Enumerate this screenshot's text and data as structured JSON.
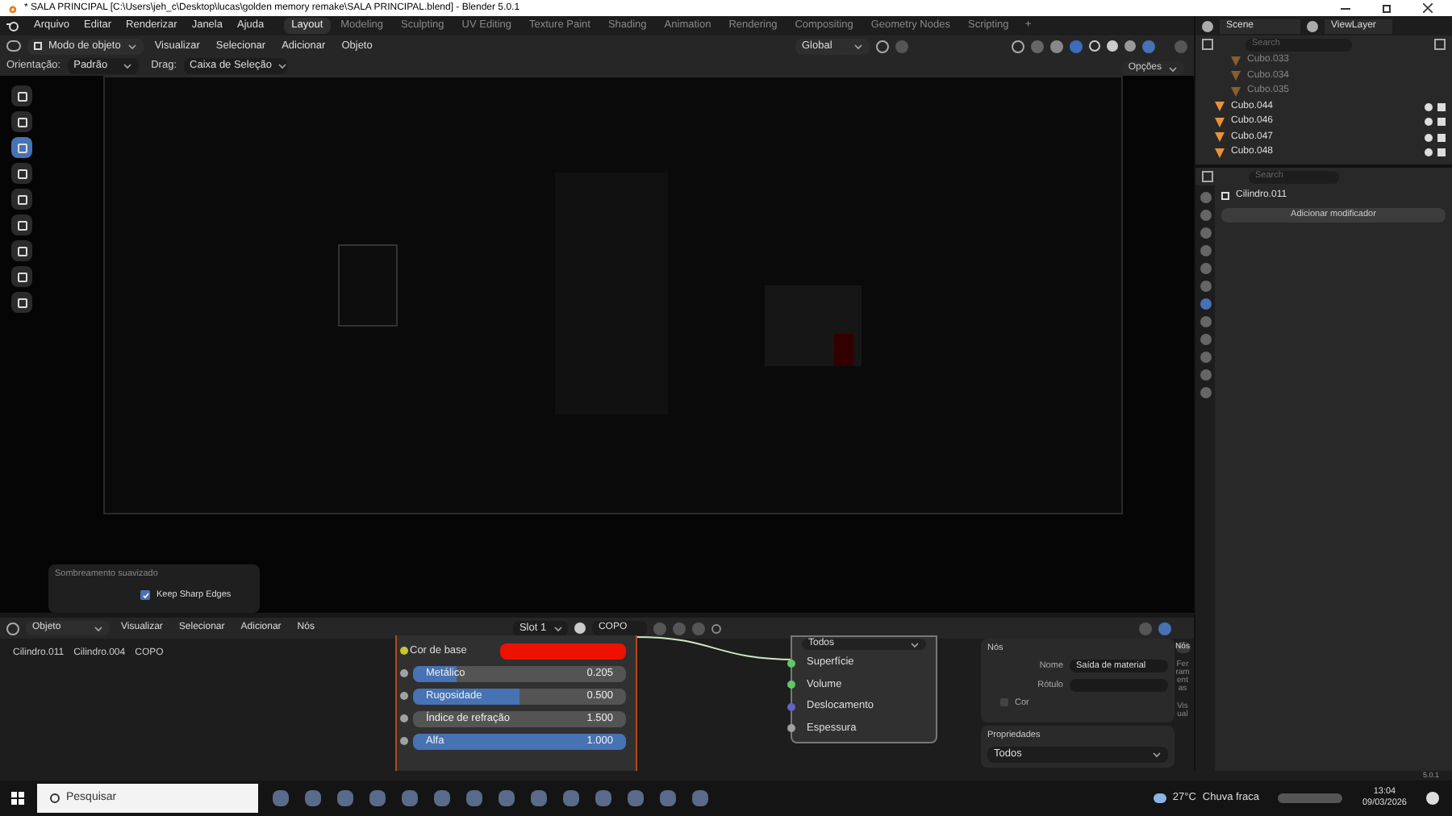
{
  "window": {
    "title": "* SALA PRINCIPAL [C:\\Users\\jeh_c\\Desktop\\lucas\\golden memory remake\\SALA PRINCIPAL.blend] - Blender 5.0.1"
  },
  "menu": [
    "Arquivo",
    "Editar",
    "Renderizar",
    "Janela",
    "Ajuda"
  ],
  "workspaces": [
    {
      "label": "Layout",
      "selected": true
    },
    {
      "label": "Modeling",
      "selected": false
    },
    {
      "label": "Sculpting",
      "selected": false
    },
    {
      "label": "UV Editing",
      "selected": false
    },
    {
      "label": "Texture Paint",
      "selected": false
    },
    {
      "label": "Shading",
      "selected": false
    },
    {
      "label": "Animation",
      "selected": false
    },
    {
      "label": "Rendering",
      "selected": false
    },
    {
      "label": "Compositing",
      "selected": false
    },
    {
      "label": "Geometry Nodes",
      "selected": false
    },
    {
      "label": "Scripting",
      "selected": false
    }
  ],
  "add_workspace": "+",
  "viewport_header": {
    "mode": "Modo de objeto",
    "menus": [
      "Visualizar",
      "Selecionar",
      "Adicionar",
      "Objeto"
    ],
    "orientation": "Global"
  },
  "tool_settings": {
    "orientation_label": "Orientação:",
    "orientation": "Padrão",
    "drag_label": "Drag:",
    "drag": "Caixa de Seleção",
    "options": "Opções"
  },
  "toolbar": [
    {
      "selected": false
    },
    {
      "selected": false
    },
    {
      "selected": true
    },
    {
      "selected": false
    },
    {
      "selected": false
    },
    {
      "selected": false
    },
    {
      "selected": false
    },
    {
      "selected": false
    },
    {
      "selected": false
    }
  ],
  "last_operator": {
    "title": "Sombreamento suavizado",
    "option": {
      "label": "Keep Sharp Edges",
      "checked": true
    }
  },
  "scene": {
    "name": "Scene",
    "view_layer": "ViewLayer"
  },
  "outliner": {
    "search_placeholder": "Search",
    "items": [
      {
        "name": "Cubo.033",
        "dimmed": true
      },
      {
        "name": "Cubo.034",
        "dimmed": true
      },
      {
        "name": "Cubo.035",
        "dimmed": true
      },
      {
        "name": "Cubo.044",
        "dimmed": false
      },
      {
        "name": "Cubo.046",
        "dimmed": false
      },
      {
        "name": "Cubo.047",
        "dimmed": false
      },
      {
        "name": "Cubo.048",
        "dimmed": false
      }
    ]
  },
  "properties": {
    "search_placeholder": "Search",
    "object": "Cilindro.011",
    "add_modifier": "Adicionar modificador",
    "tabs": [
      {
        "selected": false
      },
      {
        "selected": false
      },
      {
        "selected": false
      },
      {
        "selected": false
      },
      {
        "selected": false
      },
      {
        "selected": false
      },
      {
        "selected": true
      },
      {
        "selected": false
      },
      {
        "selected": false
      },
      {
        "selected": false
      },
      {
        "selected": false
      },
      {
        "selected": false
      }
    ]
  },
  "node_editor": {
    "mode": "Objeto",
    "menus": [
      "Visualizar",
      "Selecionar",
      "Adicionar",
      "Nós"
    ],
    "slot": "Slot 1",
    "material": "COPO",
    "breadcrumb": [
      "Cilindro.011",
      "Cilindro.004",
      "COPO"
    ],
    "bsdf_rows": [
      {
        "kind": "color",
        "label": "Cor de base",
        "color": "#ee1100"
      },
      {
        "kind": "slider",
        "label": "Metálico",
        "value": "0.205",
        "level": 0.205
      },
      {
        "kind": "slider",
        "label": "Rugosidade",
        "value": "0.500",
        "level": 0.5
      },
      {
        "kind": "number",
        "label": "Índice de refração",
        "value": "1.500"
      },
      {
        "kind": "slider",
        "label": "Alfa",
        "value": "1.000",
        "level": 1
      }
    ],
    "output": {
      "target": "Todos",
      "sockets": [
        {
          "label": "Superfície",
          "color": "#63c763"
        },
        {
          "label": "Volume",
          "color": "#63c763"
        },
        {
          "label": "Deslocamento",
          "color": "#6363c7"
        },
        {
          "label": "Espessura",
          "color": "#a1a1a1"
        }
      ]
    },
    "sidebar": {
      "node_title": "Nós",
      "name_label": "Nome",
      "name": "Saída de material",
      "label_label": "Rótulo",
      "color_label": "Cor",
      "color_enabled": false,
      "properties_title": "Propriedades",
      "properties_target": "Todos",
      "tabs": [
        {
          "label": "Nós",
          "selected": true
        },
        {
          "label": "Ferramentas",
          "selected": false
        },
        {
          "label": "Visual",
          "selected": false
        }
      ]
    }
  },
  "status_bar": {
    "version": "5.0.1"
  },
  "taskbar": {
    "search_placeholder": "Pesquisar",
    "temperature": "27°C",
    "weather": "Chuva fraca",
    "time": "13:04",
    "date": "09/03/2026"
  }
}
